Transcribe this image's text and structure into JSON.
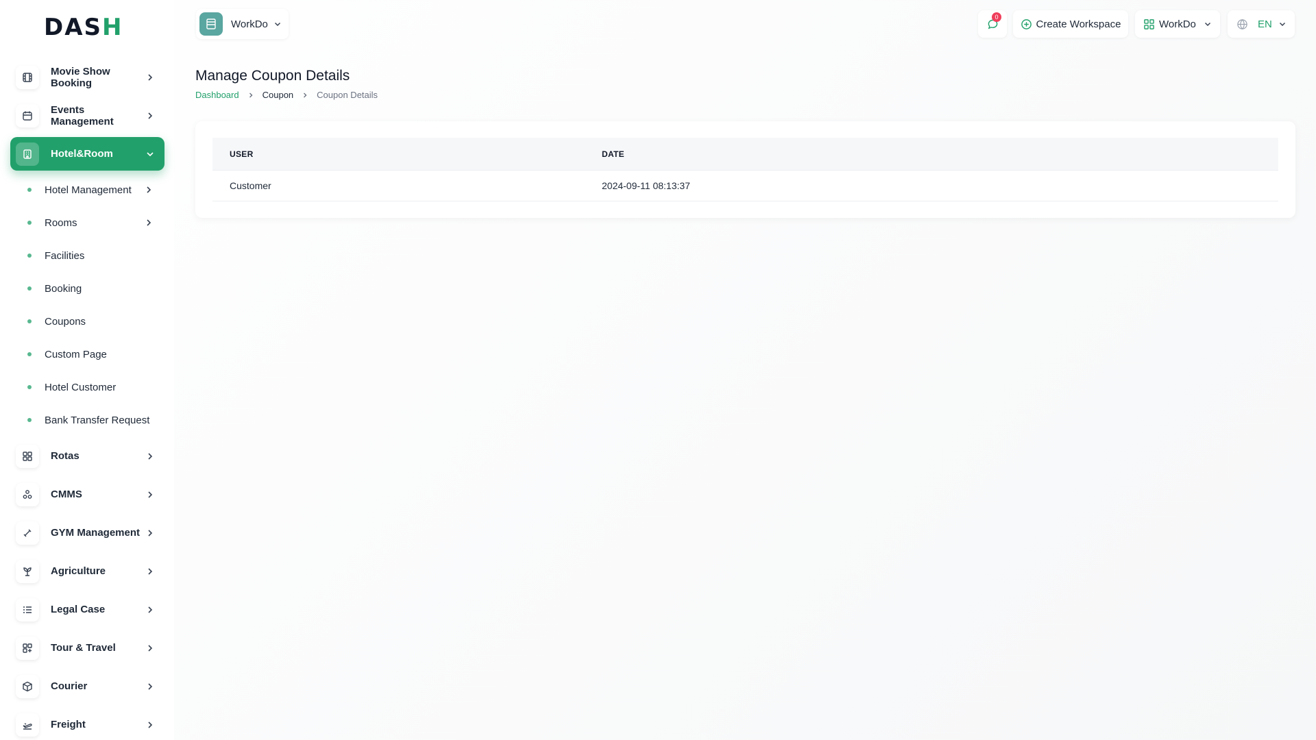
{
  "brand": {
    "logo_text_main": "DAS",
    "logo_text_accent": "H"
  },
  "sidebar": {
    "items": [
      {
        "label": "Movie Show Booking",
        "icon": "film-icon"
      },
      {
        "label": "Events Management",
        "icon": "calendar-icon"
      },
      {
        "label": "Hotel&Room",
        "icon": "building-icon",
        "active": true
      }
    ],
    "subitems": [
      {
        "label": "Hotel Management",
        "has_children": true
      },
      {
        "label": "Rooms",
        "has_children": true
      },
      {
        "label": "Facilities"
      },
      {
        "label": "Booking"
      },
      {
        "label": "Coupons"
      },
      {
        "label": "Custom Page"
      },
      {
        "label": "Hotel Customer"
      },
      {
        "label": "Bank Transfer Request"
      }
    ],
    "more_items": [
      {
        "label": "Rotas",
        "icon": "grid-icon"
      },
      {
        "label": "CMMS",
        "icon": "nodes-icon"
      },
      {
        "label": "GYM Management",
        "icon": "dumbbell-icon"
      },
      {
        "label": "Agriculture",
        "icon": "plant-icon"
      },
      {
        "label": "Legal Case",
        "icon": "list-icon"
      },
      {
        "label": "Tour & Travel",
        "icon": "grid-plus-icon"
      },
      {
        "label": "Courier",
        "icon": "box-icon"
      },
      {
        "label": "Freight",
        "icon": "plane-icon"
      }
    ]
  },
  "header": {
    "workspace": {
      "name": "WorkDo"
    },
    "notifications": {
      "count": "0"
    },
    "create_workspace_label": "Create Workspace",
    "workspace_switch_label": "WorkDo",
    "language": "EN"
  },
  "main": {
    "title": "Manage Coupon Details",
    "breadcrumb": [
      "Dashboard",
      "Coupon",
      "Coupon Details"
    ],
    "table": {
      "columns": [
        "USER",
        "DATE"
      ],
      "rows": [
        [
          "Customer",
          "2024-09-11 08:13:37"
        ]
      ]
    }
  },
  "colors": {
    "accent": "#22a06b",
    "badge": "#ef3f5c",
    "workspace_logo": "#5aa6a0"
  }
}
